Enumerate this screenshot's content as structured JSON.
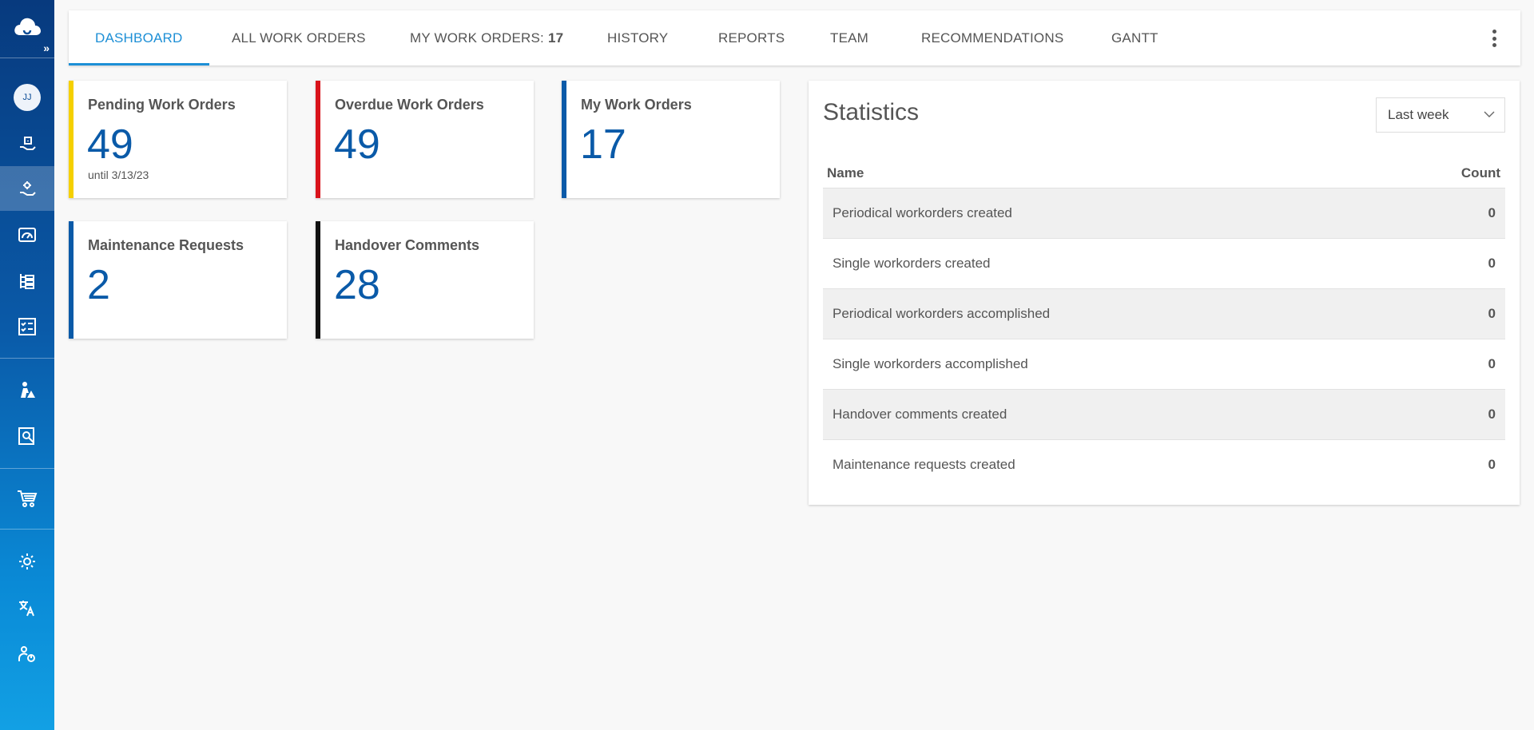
{
  "sidebar": {
    "avatar_initials": "JJ",
    "expand_label": "»",
    "items": [
      {
        "icon": "hand-wrench-icon"
      },
      {
        "icon": "hand-gear-icon"
      },
      {
        "icon": "gauge-icon"
      },
      {
        "icon": "hierarchy-icon"
      },
      {
        "icon": "checklist-icon"
      },
      {
        "icon": "person-warning-icon"
      },
      {
        "icon": "document-search-icon"
      },
      {
        "icon": "cart-icon"
      },
      {
        "icon": "brightness-icon"
      },
      {
        "icon": "translate-icon"
      },
      {
        "icon": "user-logout-icon"
      }
    ]
  },
  "tabs": [
    {
      "label": "DASHBOARD",
      "active": true
    },
    {
      "label": "ALL WORK ORDERS"
    },
    {
      "label": "MY WORK ORDERS:",
      "count": "17"
    },
    {
      "label": "HISTORY"
    },
    {
      "label": "REPORTS"
    },
    {
      "label": "TEAM"
    },
    {
      "label": "RECOMMENDATIONS"
    },
    {
      "label": "GANTT"
    }
  ],
  "cards": {
    "pending": {
      "title": "Pending Work Orders",
      "value": "49",
      "sub": "until 3/13/23",
      "color": "#f5d000"
    },
    "overdue": {
      "title": "Overdue Work Orders",
      "value": "49",
      "color": "#d9131b"
    },
    "mine": {
      "title": "My Work Orders",
      "value": "17",
      "color": "#0a5aa8"
    },
    "maintenance": {
      "title": "Maintenance Requests",
      "value": "2",
      "color": "#0a5aa8"
    },
    "handover": {
      "title": "Handover Comments",
      "value": "28",
      "color": "#111111"
    }
  },
  "statistics": {
    "title": "Statistics",
    "period": "Last week",
    "headers": {
      "name": "Name",
      "count": "Count"
    },
    "rows": [
      {
        "name": "Periodical workorders created",
        "count": "0"
      },
      {
        "name": "Single workorders created",
        "count": "0"
      },
      {
        "name": "Periodical workorders accomplished",
        "count": "0"
      },
      {
        "name": "Single workorders accomplished",
        "count": "0"
      },
      {
        "name": "Handover comments created",
        "count": "0"
      },
      {
        "name": "Maintenance requests created",
        "count": "0"
      }
    ]
  }
}
